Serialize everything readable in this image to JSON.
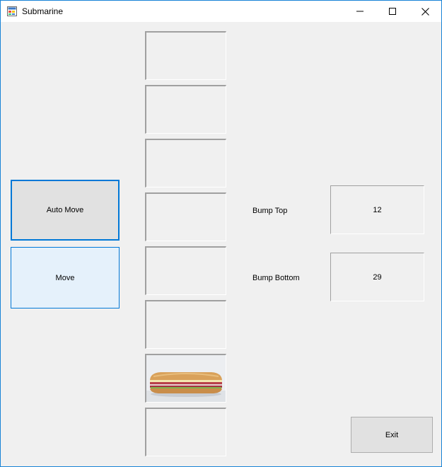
{
  "window": {
    "title": "Submarine",
    "icons": {
      "app": "app-window-icon",
      "minimize": "minimize-icon",
      "maximize": "maximize-icon",
      "close": "close-icon"
    }
  },
  "buttons": {
    "auto_move": "Auto Move",
    "move": "Move",
    "exit": "Exit"
  },
  "labels": {
    "bump_top": "Bump Top",
    "bump_bottom": "Bump Bottom"
  },
  "values": {
    "bump_top": "12",
    "bump_bottom": "29"
  },
  "lane": {
    "slots": 8,
    "sub_slot_index": 6,
    "sub_image": "submarine-sandwich-image"
  }
}
